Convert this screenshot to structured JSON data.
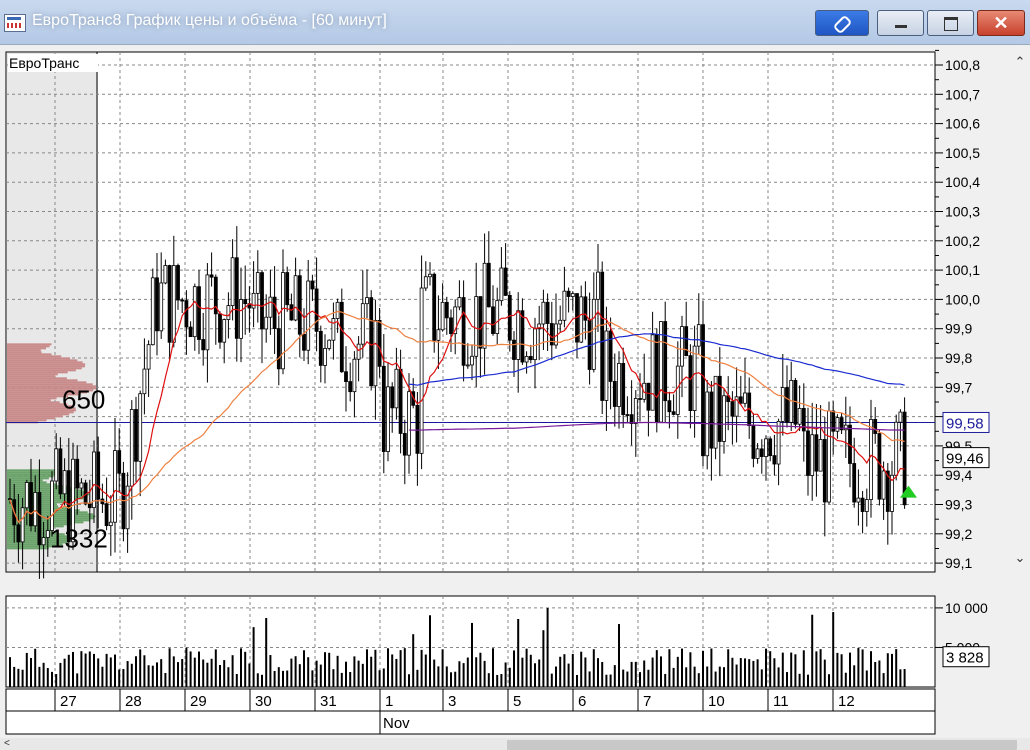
{
  "window": {
    "title": "ЕвроТранс8 График цены и объёма - [60 минут]",
    "close_label": "✕"
  },
  "chart_data": {
    "type": "candlestick",
    "instrument_label": "ЕвроТранс",
    "y_ticks": [
      "100,8",
      "100,7",
      "100,6",
      "100,5",
      "100,4",
      "100,3",
      "100,2",
      "100,1",
      "100,0",
      "99,9",
      "99,8",
      "99,7",
      "99,6",
      "99,5",
      "99,4",
      "99,3",
      "99,2",
      "99,1"
    ],
    "ylim": [
      99.05,
      100.85
    ],
    "price_labels": [
      {
        "text": "99,58",
        "value": 99.58,
        "color": "#1a1a9a"
      },
      {
        "text": "99,46",
        "value": 99.46,
        "color": "#000000"
      }
    ],
    "reference_line": {
      "value": 99.58,
      "color": "#1a1a9a"
    },
    "volume_profile": {
      "upper_label": "650",
      "lower_label": "1332",
      "upper_range": [
        99.58,
        99.85
      ],
      "lower_range": [
        99.15,
        99.42
      ],
      "upper_color": "#c98a8a",
      "lower_color": "#6aa36a"
    },
    "x_dates": [
      "27",
      "28",
      "29",
      "30",
      "31",
      "1",
      "3",
      "5",
      "6",
      "7",
      "10",
      "11",
      "12"
    ],
    "x_month": "Nov",
    "volume_ticks": [
      "10 000",
      "5 000"
    ],
    "volume_last_label": "3 828",
    "volume_max": 11000,
    "series_colors": {
      "ma_fast": "#e01010",
      "ma_slow": "#f08040",
      "ma_blue": "#1a2bd0",
      "ma_purple": "#7a1a9a"
    },
    "indicator_color": "#22cc22"
  }
}
